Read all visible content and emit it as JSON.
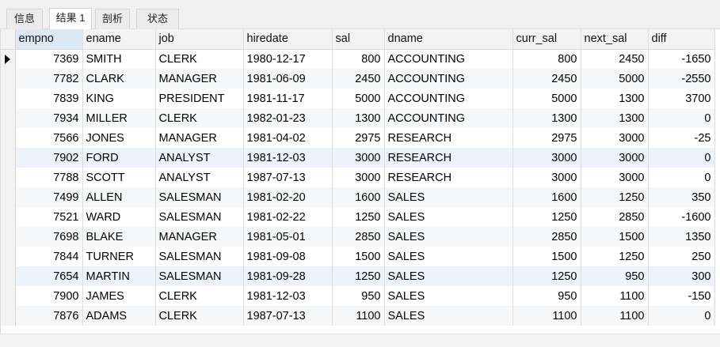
{
  "tabs": [
    {
      "label": "信息",
      "active": false
    },
    {
      "label": "结果 1",
      "active": true
    },
    {
      "label": "剖析",
      "active": false
    },
    {
      "label": "状态",
      "active": false
    }
  ],
  "table": {
    "columns": [
      "empno",
      "ename",
      "job",
      "hiredate",
      "sal",
      "dname",
      "curr_sal",
      "next_sal",
      "diff"
    ],
    "current_row": 0,
    "rows": [
      [
        "7369",
        "SMITH",
        "CLERK",
        "1980-12-17",
        "800",
        "ACCOUNTING",
        "800",
        "2450",
        "-1650"
      ],
      [
        "7782",
        "CLARK",
        "MANAGER",
        "1981-06-09",
        "2450",
        "ACCOUNTING",
        "2450",
        "5000",
        "-2550"
      ],
      [
        "7839",
        "KING",
        "PRESIDENT",
        "1981-11-17",
        "5000",
        "ACCOUNTING",
        "5000",
        "1300",
        "3700"
      ],
      [
        "7934",
        "MILLER",
        "CLERK",
        "1982-01-23",
        "1300",
        "ACCOUNTING",
        "1300",
        "1300",
        "0"
      ],
      [
        "7566",
        "JONES",
        "MANAGER",
        "1981-04-02",
        "2975",
        "RESEARCH",
        "2975",
        "3000",
        "-25"
      ],
      [
        "7902",
        "FORD",
        "ANALYST",
        "1981-12-03",
        "3000",
        "RESEARCH",
        "3000",
        "3000",
        "0"
      ],
      [
        "7788",
        "SCOTT",
        "ANALYST",
        "1987-07-13",
        "3000",
        "RESEARCH",
        "3000",
        "3000",
        "0"
      ],
      [
        "7499",
        "ALLEN",
        "SALESMAN",
        "1981-02-20",
        "1600",
        "SALES",
        "1600",
        "1250",
        "350"
      ],
      [
        "7521",
        "WARD",
        "SALESMAN",
        "1981-02-22",
        "1250",
        "SALES",
        "1250",
        "2850",
        "-1600"
      ],
      [
        "7698",
        "BLAKE",
        "MANAGER",
        "1981-05-01",
        "2850",
        "SALES",
        "2850",
        "1500",
        "1350"
      ],
      [
        "7844",
        "TURNER",
        "SALESMAN",
        "1981-09-08",
        "1500",
        "SALES",
        "1500",
        "1250",
        "250"
      ],
      [
        "7654",
        "MARTIN",
        "SALESMAN",
        "1981-09-28",
        "1250",
        "SALES",
        "1250",
        "950",
        "300"
      ],
      [
        "7900",
        "JAMES",
        "CLERK",
        "1981-12-03",
        "950",
        "SALES",
        "950",
        "1100",
        "-150"
      ],
      [
        "7876",
        "ADAMS",
        "CLERK",
        "1987-07-13",
        "1100",
        "SALES",
        "1100",
        "1100",
        "0"
      ]
    ]
  }
}
